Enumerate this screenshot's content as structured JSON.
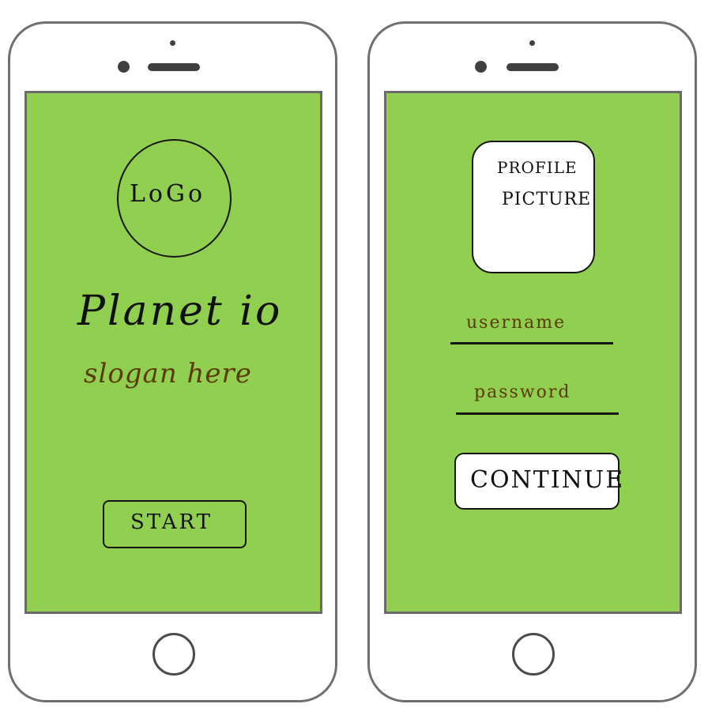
{
  "screens": [
    {
      "name": "start-screen",
      "logo_label": "LoGo",
      "app_name": "Planet io",
      "slogan": "slogan here",
      "start_button_label": "START"
    },
    {
      "name": "login-screen",
      "profile_picture_label_line1": "PROFILE",
      "profile_picture_label_line2": "PICTURE",
      "username_placeholder": "username",
      "password_placeholder": "password",
      "continue_button_label": "CONTINUE"
    }
  ],
  "colors": {
    "screen_background": "#91cf51",
    "device_frame": "#6f6f6f",
    "sketch_ink": "#151515",
    "placeholder_ink": "#5b3a07",
    "button_fill_white": "#ffffff"
  }
}
